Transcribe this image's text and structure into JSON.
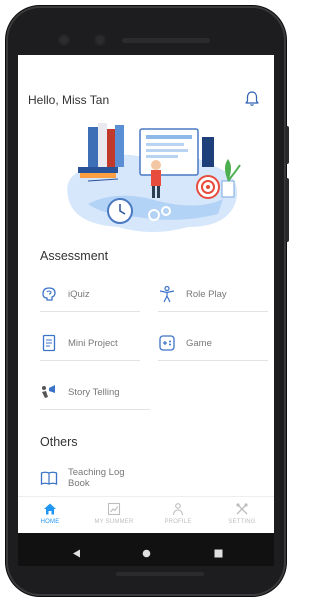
{
  "header": {
    "greeting": "Hello, Miss Tan",
    "notification_icon": "bell-icon"
  },
  "assessment": {
    "title": "Assessment",
    "items": [
      {
        "label": "iQuiz",
        "icon": "brain-head-icon"
      },
      {
        "label": "Role Play",
        "icon": "person-icon"
      },
      {
        "label": "Mini Project",
        "icon": "document-icon"
      },
      {
        "label": "Game",
        "icon": "controller-icon"
      },
      {
        "label": "Story Telling",
        "icon": "megaphone-icon"
      }
    ]
  },
  "others": {
    "title": "Others",
    "items": [
      {
        "label": "Teaching Log Book",
        "icon": "book-icon"
      }
    ]
  },
  "bottom_nav": {
    "items": [
      {
        "label": "HOME",
        "icon": "home-icon",
        "active": true
      },
      {
        "label": "MY SUMMER",
        "icon": "chart-icon",
        "active": false
      },
      {
        "label": "PROFILE",
        "icon": "profile-icon",
        "active": false
      },
      {
        "label": "SETTING",
        "icon": "tools-icon",
        "active": false
      }
    ]
  },
  "colors": {
    "accent": "#2196f3",
    "icon_blue": "#3b73c8",
    "text_muted": "#777777"
  }
}
